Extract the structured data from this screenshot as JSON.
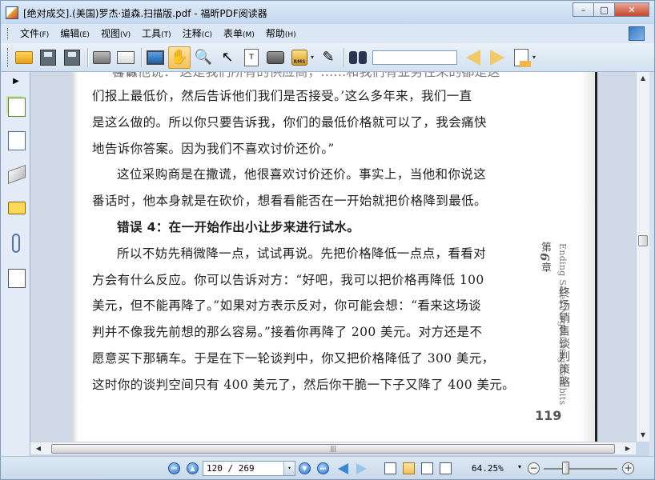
{
  "window": {
    "title": "[绝对成交].(美国)罗杰·道森.扫描版.pdf - 福昕PDF阅读器",
    "minimize_glyph": "–",
    "maximize_glyph": "□",
    "close_glyph": "✕"
  },
  "menu": {
    "items": [
      {
        "label": "文件",
        "key": "(F)"
      },
      {
        "label": "编辑",
        "key": "(E)"
      },
      {
        "label": "视图",
        "key": "(V)"
      },
      {
        "label": "工具",
        "key": "(T)"
      },
      {
        "label": "注释",
        "key": "(C)"
      },
      {
        "label": "表单",
        "key": "(M)"
      },
      {
        "label": "帮助",
        "key": "(H)"
      }
    ]
  },
  "toolbar": {
    "hand_glyph": "✋",
    "zoom_glyph": "🔍",
    "select_glyph": "↖",
    "text_select_glyph": "T",
    "rms_label": "RMS",
    "sign_glyph": "✎",
    "dropdown_glyph": "▾",
    "search_value": ""
  },
  "left_panel": {
    "toggle_glyph": "▶"
  },
  "document": {
    "lines": [
      {
        "type": "normal",
        "text": "们报上最低价，然后告诉他们我们是否接受。’这么多年来，我们一直"
      },
      {
        "type": "normal",
        "text": "是这么做的。所以你只要告诉我，你们的最低价格就可以了，我会痛快"
      },
      {
        "type": "normal",
        "text": "地告诉你答案。因为我们不喜欢讨价还价。”"
      },
      {
        "type": "indent",
        "text": "这位采购商是在撒谎，他很喜欢讨价还价。事实上，当他和你说这"
      },
      {
        "type": "normal",
        "text": "番话时，他本身就是在砍价，想看看能否在一开始就把价格降到最低。"
      },
      {
        "type": "heading",
        "text": "错误 4：在一开始作出小让步来进行试水。"
      },
      {
        "type": "indent",
        "text": "所以不妨先稍微降一点，试试再说。先把价格降低一点点，看看对"
      },
      {
        "type": "normal",
        "text": "方会有什么反应。你可以告诉对方：“好吧，我可以把价格再降低 100"
      },
      {
        "type": "normal",
        "text": "美元，但不能再降了。”如果对方表示反对，你可能会想：“看来这场谈"
      },
      {
        "type": "normal",
        "text": "判并不像我先前想的那么容易。”接着你再降了 200 美元。对方还是不"
      },
      {
        "type": "normal",
        "text": "愿意买下那辆车。于是在下一轮谈判中，你又把价格降低了 300 美元，"
      },
      {
        "type": "normal",
        "text": "这时你的谈判空间只有 400 美元了，然后你干脆一下子又降了 400 美元。"
      }
    ],
    "top_cut_text": "告诉他说：'这是我们所有的供应商，……和我们有业务往来的都是这样做'",
    "chapter_label_prefix": "第",
    "chapter_number": "6",
    "chapter_label_suffix": "章",
    "chapter_title_en": "Ending Sales Negotiating Gambits",
    "chapter_title_zh": "终场销售谈判策略",
    "page_number": "119"
  },
  "scroll": {
    "up_glyph": "▲",
    "down_glyph": "▼",
    "left_glyph": "◀",
    "right_glyph": "▶",
    "hthumb_grip": "|||"
  },
  "statusbar": {
    "page_display": "120 / 269",
    "zoom": "64.25%",
    "dropdown_glyph": "▾",
    "zoom_out_glyph": "−",
    "zoom_in_glyph": "+",
    "first_glyph": "⏮",
    "prev_glyph": "▲",
    "next_glyph": "▼",
    "last_glyph": "⏭"
  }
}
